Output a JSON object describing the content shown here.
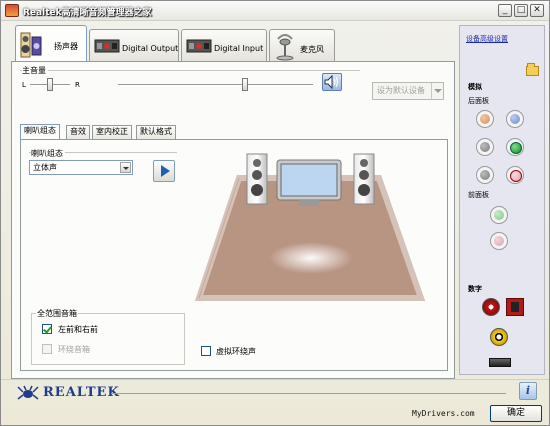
{
  "window": {
    "title": "Realtek高清晰音频管理器之家"
  },
  "device_tabs": [
    {
      "label": "扬声器",
      "icon": "speaker-icon"
    },
    {
      "label": "Digital Output",
      "icon": "digital-output-icon"
    },
    {
      "label": "Digital Input",
      "icon": "digital-input-icon"
    },
    {
      "label": "麦克风",
      "icon": "microphone-icon"
    }
  ],
  "volume": {
    "title": "主音量",
    "left_label": "L",
    "right_label": "R",
    "balance_percent": 50,
    "level_percent": 66,
    "set_default_label": "设为默认设备"
  },
  "sub_tabs": [
    "喇叭组态",
    "音效",
    "室内校正",
    "默认格式"
  ],
  "config": {
    "title": "喇叭组态",
    "selected": "立体声"
  },
  "full_range": {
    "title": "全范围音箱",
    "front_label": "左前和右前",
    "front_checked": true,
    "surround_label": "环绕音箱",
    "surround_checked": false
  },
  "virtual_surround": {
    "label": "虚拟环绕声",
    "checked": false
  },
  "right_panel": {
    "advanced_link": "设备高级设置",
    "analog_label": "模拟",
    "back_panel_label": "后面板",
    "front_panel_label": "前面板",
    "digital_label": "数字"
  },
  "bottom": {
    "brand": "REALTEK",
    "watermark": "MyDrivers.com",
    "ok_label": "确定"
  },
  "colors": {
    "brand_blue": "#1f3d8a",
    "link_blue": "#1a2aa8",
    "floor": "#b89483"
  }
}
